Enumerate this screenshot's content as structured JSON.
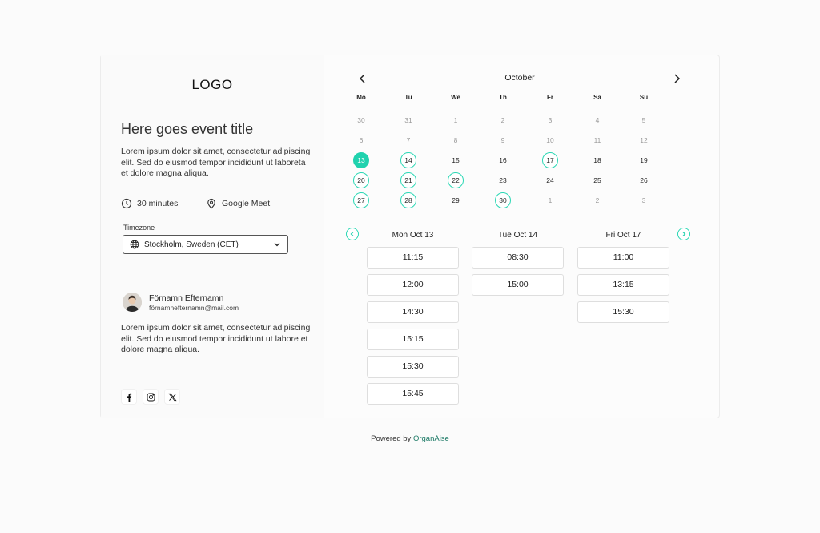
{
  "logo": "LOGO",
  "event": {
    "title": "Here goes event title",
    "description": "Lorem ipsum dolor sit amet, consectetur adipiscing elit. Sed do eiusmod tempor incididunt ut laboreta et dolore magna aliqua.",
    "duration": "30 minutes",
    "location": "Google Meet"
  },
  "timezone": {
    "label": "Timezone",
    "value": "Stockholm, Sweden (CET)"
  },
  "host": {
    "name": "Förnamn Efternamn",
    "email": "förnamnefternamn@mail.com",
    "description": "Lorem ipsum dolor sit amet, consectetur adipiscing elit. Sed do eiusmod tempor incididunt ut labore et dolore magna aliqua."
  },
  "socials": [
    "facebook-icon",
    "instagram-icon",
    "x-icon"
  ],
  "calendar": {
    "month": "October",
    "weekdays": [
      "Mo",
      "Tu",
      "We",
      "Th",
      "Fr",
      "Sa",
      "Su"
    ],
    "weeks": [
      [
        {
          "d": "30",
          "s": "muted"
        },
        {
          "d": "31",
          "s": "muted"
        },
        {
          "d": "1",
          "s": "muted"
        },
        {
          "d": "2",
          "s": "muted"
        },
        {
          "d": "3",
          "s": "muted"
        },
        {
          "d": "4",
          "s": "muted"
        },
        {
          "d": "5",
          "s": "muted"
        }
      ],
      [
        {
          "d": "6",
          "s": "muted"
        },
        {
          "d": "7",
          "s": "muted"
        },
        {
          "d": "8",
          "s": "muted"
        },
        {
          "d": "9",
          "s": "muted"
        },
        {
          "d": "10",
          "s": "muted"
        },
        {
          "d": "11",
          "s": "muted"
        },
        {
          "d": "12",
          "s": "muted"
        }
      ],
      [
        {
          "d": "13",
          "s": "sel"
        },
        {
          "d": "14",
          "s": "avail"
        },
        {
          "d": "15",
          "s": ""
        },
        {
          "d": "16",
          "s": ""
        },
        {
          "d": "17",
          "s": "avail"
        },
        {
          "d": "18",
          "s": ""
        },
        {
          "d": "19",
          "s": ""
        }
      ],
      [
        {
          "d": "20",
          "s": "avail"
        },
        {
          "d": "21",
          "s": "avail"
        },
        {
          "d": "22",
          "s": "avail"
        },
        {
          "d": "23",
          "s": ""
        },
        {
          "d": "24",
          "s": ""
        },
        {
          "d": "25",
          "s": ""
        },
        {
          "d": "26",
          "s": ""
        }
      ],
      [
        {
          "d": "27",
          "s": "avail"
        },
        {
          "d": "28",
          "s": "avail"
        },
        {
          "d": "29",
          "s": ""
        },
        {
          "d": "30",
          "s": "avail"
        },
        {
          "d": "1",
          "s": "muted"
        },
        {
          "d": "2",
          "s": "muted"
        },
        {
          "d": "3",
          "s": "muted"
        }
      ]
    ]
  },
  "slots": [
    {
      "day": "Mon Oct 13",
      "times": [
        "11:15",
        "12:00",
        "14:30",
        "15:15",
        "15:30",
        "15:45"
      ]
    },
    {
      "day": "Tue Oct 14",
      "times": [
        "08:30",
        "15:00"
      ]
    },
    {
      "day": "Fri Oct 17",
      "times": [
        "11:00",
        "13:15",
        "15:30"
      ]
    }
  ],
  "footer": {
    "prefix": "Powered by",
    "brand": "OrganAise"
  },
  "colors": {
    "accent": "#20d2ae",
    "brand": "#1c7a66"
  }
}
